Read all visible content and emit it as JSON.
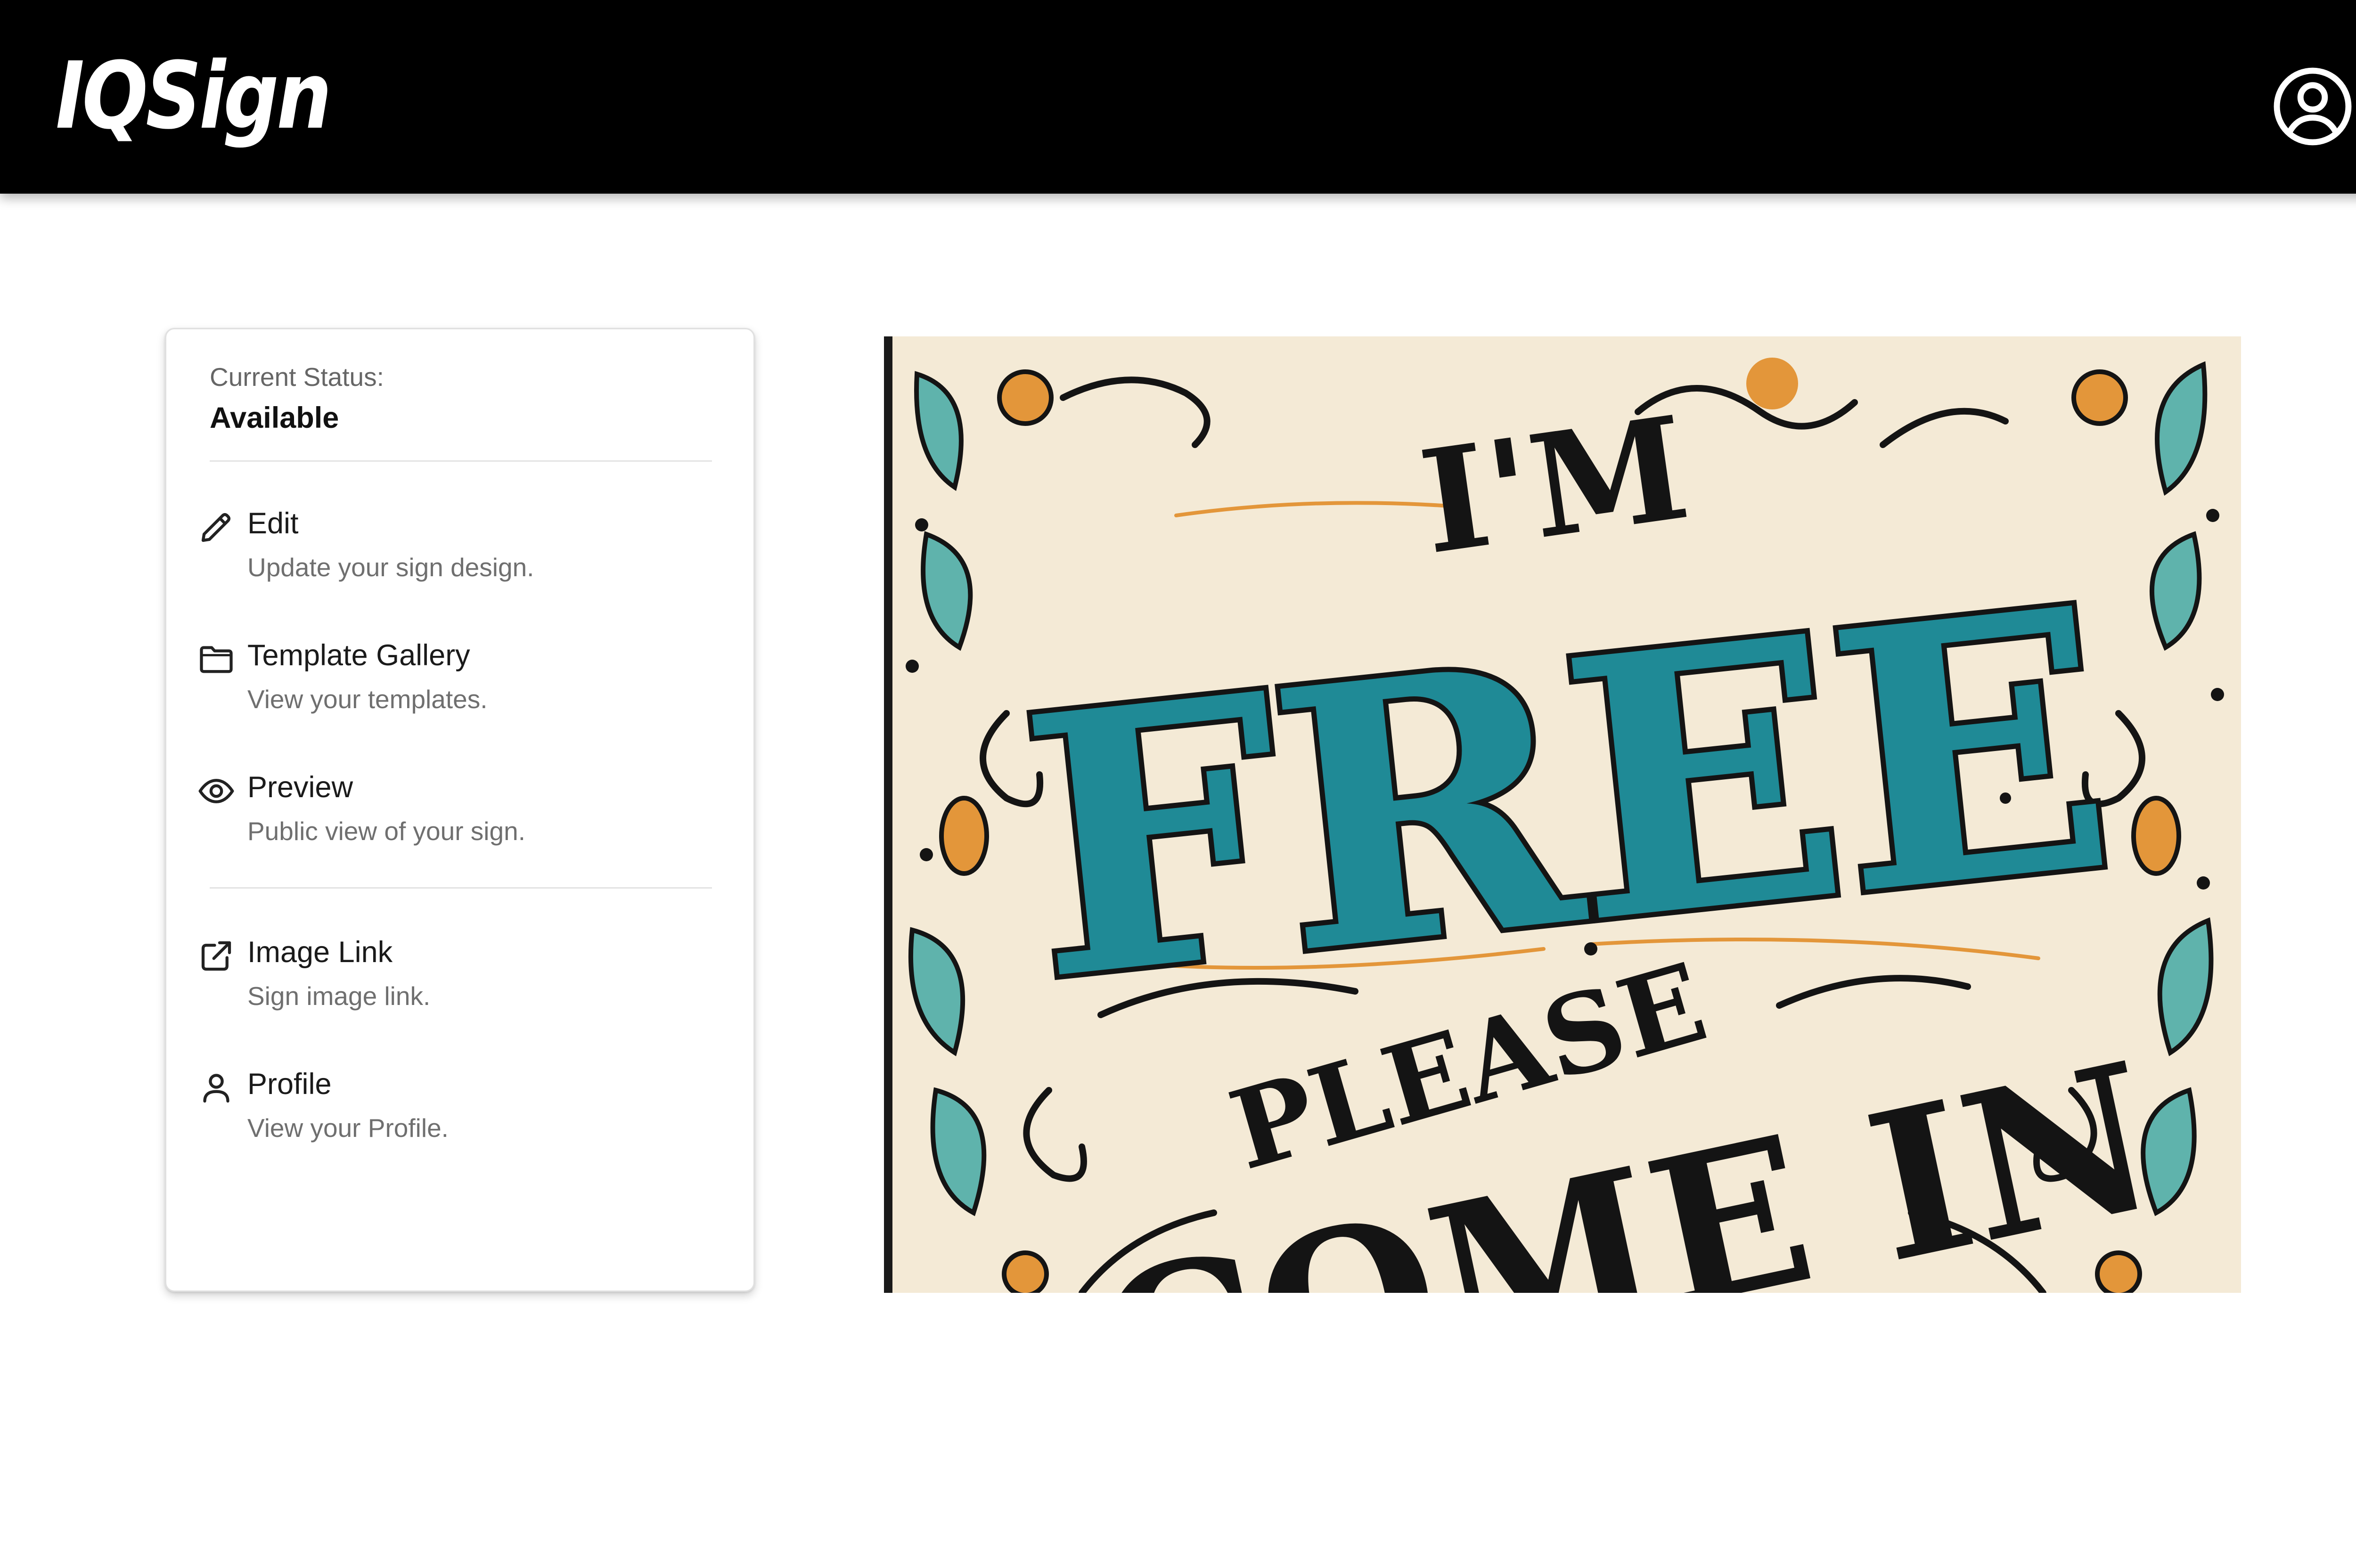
{
  "app": {
    "logo_text": "IQSign",
    "account_icon": "account-circle-icon"
  },
  "status": {
    "label": "Current Status:",
    "value": "Available"
  },
  "menu": {
    "items": [
      {
        "title": "Edit",
        "description": "Update your sign design.",
        "icon": "pencil-icon"
      },
      {
        "title": "Template Gallery",
        "description": "View your templates.",
        "icon": "folder-icon"
      },
      {
        "title": "Preview",
        "description": "Public view of your sign.",
        "icon": "eye-icon"
      },
      {
        "title": "Image Link",
        "description": "Sign image link.",
        "icon": "external-link-icon"
      },
      {
        "title": "Profile",
        "description": "View your Profile.",
        "icon": "person-icon"
      }
    ]
  },
  "sign": {
    "text_line1": "I'M",
    "text_line2": "FREE",
    "text_line3": "PLEASE",
    "text_line4": "COME IN"
  },
  "colors": {
    "header_bg": "#000000",
    "sign_background": "#f4ead6",
    "sign_teal": "#1f8a96",
    "sign_orange": "#e3963a",
    "sign_ink": "#141414"
  }
}
